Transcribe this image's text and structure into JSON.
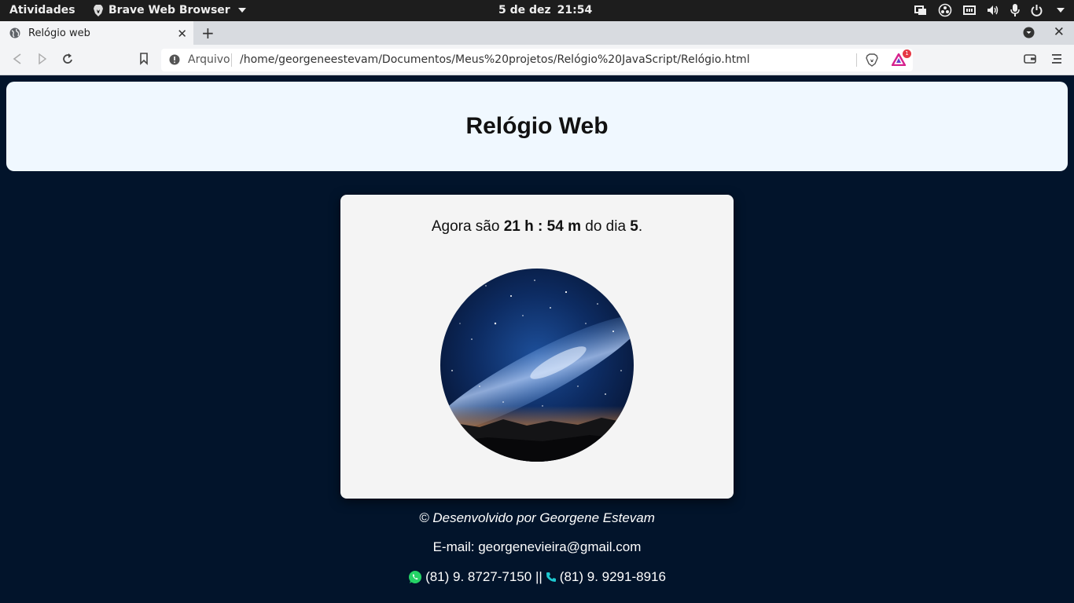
{
  "os_topbar": {
    "activities": "Atividades",
    "app_name": "Brave Web Browser",
    "date": "5 de dez",
    "time": "21:54"
  },
  "browser": {
    "tab_title": "Relógio web",
    "new_tab": "+",
    "close_tab": "✕",
    "window_close": "✕",
    "url_scheme": "Arquivo",
    "url": "/home/georgeneestevam/Documentos/Meus%20projetos/Relógio%20JavaScript/Relógio.html",
    "rewards_badge": "1"
  },
  "page": {
    "title": "Relógio Web",
    "msg_prefix": "Agora são ",
    "hours": "21 h",
    "colon": " : ",
    "minutes": "54 m",
    "msg_middle": " do dia ",
    "day": "5",
    "msg_suffix": ".",
    "credit": "© Desenvolvido por Georgene Estevam",
    "email": "E-mail: georgenevieira@gmail.com",
    "whatsapp": "(81) 9. 8727-7150 ||",
    "phone": "(81) 9. 9291-8916"
  },
  "colors": {
    "page_background": "#02142b",
    "header_background": "#f0f8ff",
    "card_background": "#f4f4f4",
    "whatsapp_green": "#25d366",
    "phone_teal": "#1ec8d0"
  }
}
